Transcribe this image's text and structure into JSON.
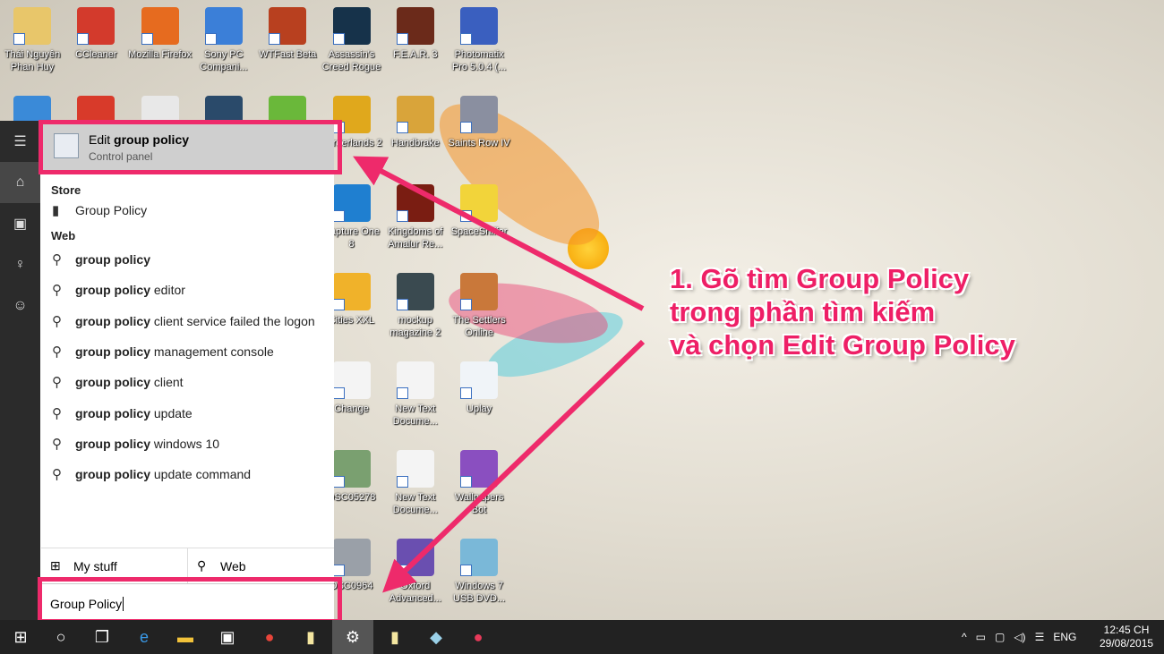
{
  "desktop": {
    "icons": [
      {
        "label": "Thái Nguyên Phan Huy",
        "color": "#e8c66a"
      },
      {
        "label": "CCleaner",
        "color": "#d33a2c"
      },
      {
        "label": "Mozilla Firefox",
        "color": "#e66b1f"
      },
      {
        "label": "Sony PC Compani...",
        "color": "#3b7fd8"
      },
      {
        "label": "WTFast Beta",
        "color": "#b8401f"
      },
      {
        "label": "Assassin's Creed Rogue",
        "color": "#16324a"
      },
      {
        "label": "F.E.A.R. 3",
        "color": "#6b2a1a"
      },
      {
        "label": "Photomatix Pro 5.0.4 (...",
        "color": "#3a5fbf"
      },
      {
        "label": "Borderlands 2",
        "color": "#e0a81c"
      },
      {
        "label": "Handbrake",
        "color": "#d9a43a"
      },
      {
        "label": "Saints Row IV",
        "color": "#8a8fa0"
      },
      {
        "label": "Capture One 8",
        "color": "#1f7fd0"
      },
      {
        "label": "Kingdoms of Amalur Re...",
        "color": "#7a1d12"
      },
      {
        "label": "SpaceSniffer",
        "color": "#f2d43a"
      },
      {
        "label": "Cities XXL",
        "color": "#f0b22a"
      },
      {
        "label": "mockup magazine 2",
        "color": "#3a4a50"
      },
      {
        "label": "The Settlers Online",
        "color": "#c9783a"
      },
      {
        "label": "Change",
        "color": "#f4f4f4"
      },
      {
        "label": "New Text Docume...",
        "color": "#f4f4f4"
      },
      {
        "label": "Uplay",
        "color": "#f0f4f8"
      },
      {
        "label": "DSC05278",
        "color": "#7aa070"
      },
      {
        "label": "New Text Docume...",
        "color": "#f4f4f4"
      },
      {
        "label": "Wallpapers Bot",
        "color": "#8a4fc0"
      },
      {
        "label": "DSC0964",
        "color": "#9aa0a8"
      },
      {
        "label": "Oxford Advanced...",
        "color": "#6a4fb0"
      },
      {
        "label": "Windows 7 USB DVD...",
        "color": "#7ab8d8"
      }
    ]
  },
  "start": {
    "rail": [
      {
        "icon": "hamburger-icon",
        "glyph": "☰"
      },
      {
        "icon": "home-icon",
        "glyph": "⌂"
      },
      {
        "icon": "notebook-icon",
        "glyph": "▣"
      },
      {
        "icon": "lightbulb-icon",
        "glyph": "♀"
      },
      {
        "icon": "feedback-icon",
        "glyph": "☺"
      }
    ],
    "best": {
      "title_pre": "Edit ",
      "title_bold": "group policy",
      "subtitle": "Control panel"
    },
    "store_header": "Store",
    "store_item": "Group Policy",
    "web_header": "Web",
    "web_items": [
      {
        "bold": "group policy",
        "rest": ""
      },
      {
        "bold": "group policy",
        "rest": " editor"
      },
      {
        "bold": "group policy",
        "rest": " client service failed the logon"
      },
      {
        "bold": "group policy",
        "rest": " management console"
      },
      {
        "bold": "group policy",
        "rest": " client"
      },
      {
        "bold": "group policy",
        "rest": " update"
      },
      {
        "bold": "group policy",
        "rest": " windows 10"
      },
      {
        "bold": "group policy",
        "rest": " update command"
      }
    ],
    "my_stuff": "My stuff",
    "web": "Web",
    "search_value": "Group Policy"
  },
  "annotation": {
    "line1": "1. Gõ tìm Group Policy",
    "line2": "trong phần tìm kiếm",
    "line3": "và chọn Edit Group Policy",
    "color": "#ee1f66"
  },
  "taskbar": {
    "time": "12:45 CH",
    "date": "29/08/2015",
    "lang": "ENG"
  }
}
